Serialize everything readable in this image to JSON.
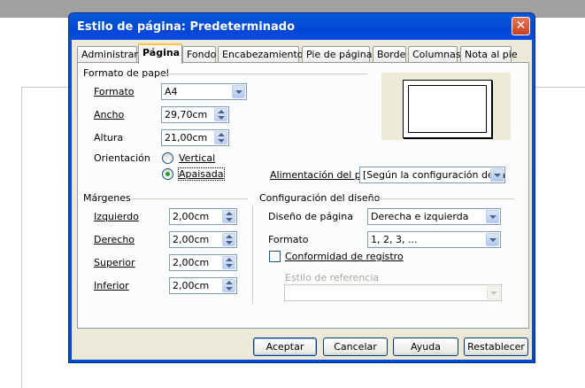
{
  "window": {
    "title": "Estilo de página: Predeterminado",
    "close_label": "✕"
  },
  "tabs": [
    "Administrar",
    "Página",
    "Fondo",
    "Encabezamiento",
    "Pie de página",
    "Borde",
    "Columnas",
    "Nota al pie"
  ],
  "active_tab": "Página",
  "paper": {
    "group_label": "Formato de papel",
    "format_label": "Formato",
    "format_value": "A4",
    "width_label": "Ancho",
    "width_value": "29,70cm",
    "height_label": "Altura",
    "height_value": "21,00cm",
    "orientation_label": "Orientación",
    "vertical_label": "Vertical",
    "landscape_label": "Apaisada",
    "orientation_selected": "Apaisada",
    "tray_label": "Alimentación del pap",
    "tray_value": "[Según la configuración de la"
  },
  "margins": {
    "group_label": "Márgenes",
    "left_label": "Izquierdo",
    "left_value": "2,00cm",
    "right_label": "Derecho",
    "right_value": "2,00cm",
    "top_label": "Superior",
    "top_value": "2,00cm",
    "bottom_label": "Inferior",
    "bottom_value": "2,00cm"
  },
  "layout": {
    "group_label": "Configuración del diseño",
    "page_layout_label": "Diseño de página",
    "page_layout_value": "Derecha e izquierda",
    "format_label": "Formato",
    "format_value": "1, 2, 3, ...",
    "register_label": "Conformidad de registro",
    "register_checked": false,
    "reference_style_label": "Estilo de referencia",
    "reference_style_value": ""
  },
  "buttons": {
    "ok": "Aceptar",
    "cancel": "Cancelar",
    "help": "Ayuda",
    "reset": "Restablecer"
  },
  "colors": {
    "titlebar": "#0054e3",
    "dialog_bg": "#ece9d8",
    "panel_bg": "#fcfcfe",
    "tab_highlight": "#ffc83c",
    "close_button": "#c8401f"
  }
}
